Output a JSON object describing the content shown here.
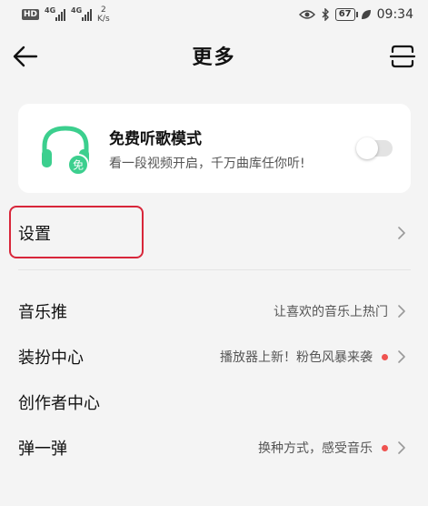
{
  "status_bar": {
    "hd_label": "HD",
    "sim1_gen": "4G",
    "sim2_gen": "4G",
    "speed_value": "2",
    "speed_unit": "K/s",
    "battery": "67",
    "time": "09:34"
  },
  "header": {
    "title": "更多"
  },
  "free_mode": {
    "title": "免费听歌模式",
    "subtitle": "看一段视频开启，千万曲库任你听!",
    "badge": "免",
    "enabled": false,
    "accent": "#3ccf8e"
  },
  "settings": {
    "label": "设置"
  },
  "menu": [
    {
      "label": "音乐推",
      "hint": "让喜欢的音乐上热门",
      "dot": false,
      "chevron": true
    },
    {
      "label": "装扮中心",
      "hint": "播放器上新！粉色风暴来袭",
      "dot": true,
      "chevron": true
    },
    {
      "label": "创作者中心",
      "hint": "",
      "dot": false,
      "chevron": false
    },
    {
      "label": "弹一弹",
      "hint": "换种方式，感受音乐",
      "dot": true,
      "chevron": true
    }
  ],
  "colors": {
    "highlight": "#d8263a",
    "dot": "#ef5350"
  }
}
